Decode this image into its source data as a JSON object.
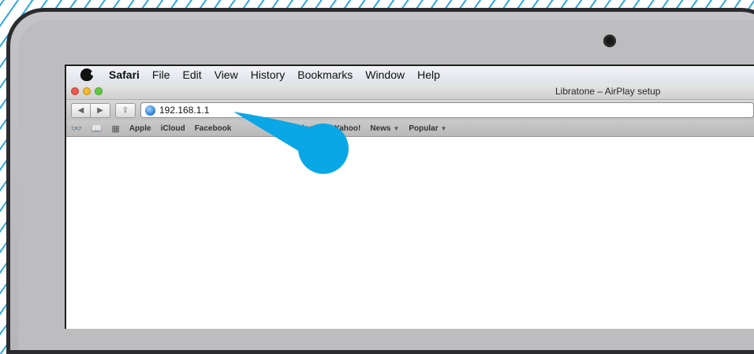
{
  "menubar": {
    "app_name": "Safari",
    "items": [
      "File",
      "Edit",
      "View",
      "History",
      "Bookmarks",
      "Window",
      "Help"
    ]
  },
  "window": {
    "title": "Libratone – AirPlay setup"
  },
  "toolbar": {
    "back_label": "◀",
    "forward_label": "▶",
    "share_label": "⇪",
    "url": "192.168.1.1"
  },
  "bookmarks": {
    "icons": {
      "reading_list": "👓",
      "bookmarks": "📖",
      "top_sites": "▦"
    },
    "items": [
      {
        "label": "Apple",
        "dropdown": ""
      },
      {
        "label": "iCloud",
        "dropdown": ""
      },
      {
        "label": "Facebook",
        "dropdown": ""
      },
      {
        "label": "Wikipedia",
        "dropdown": ""
      },
      {
        "label": "Yahoo!",
        "dropdown": ""
      },
      {
        "label": "News",
        "dropdown": "▼"
      },
      {
        "label": "Popular",
        "dropdown": "▼"
      }
    ]
  },
  "colors": {
    "accent": "#0aa7e6",
    "stripe": "#2fa8df"
  }
}
